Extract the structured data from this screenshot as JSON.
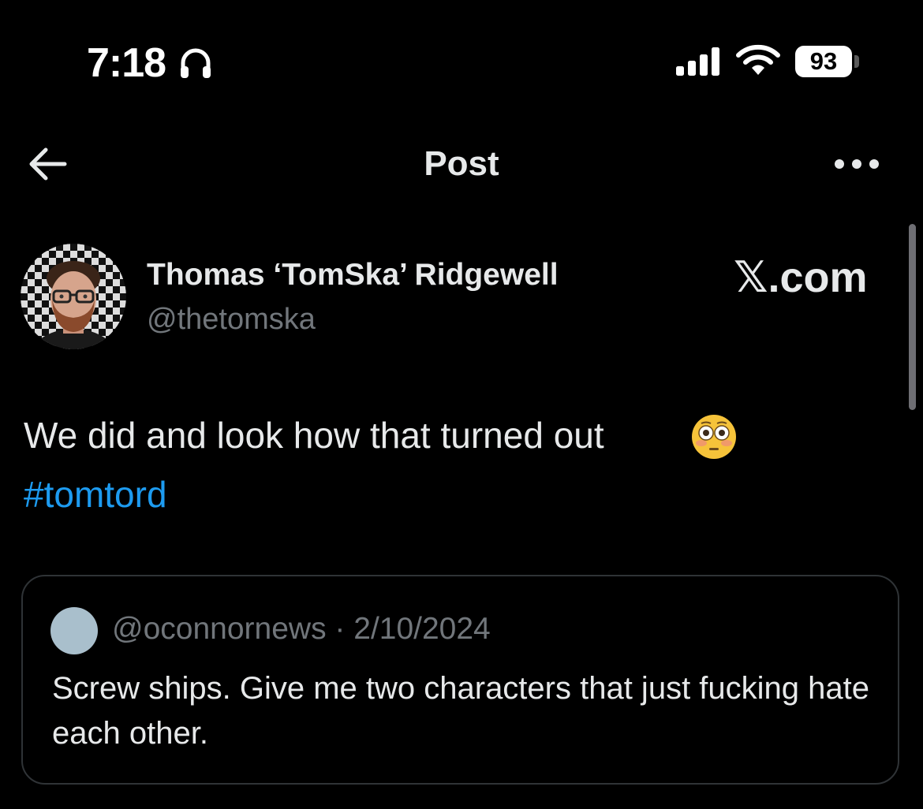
{
  "status_bar": {
    "time": "7:18",
    "battery": "93",
    "icons": [
      "headphones-icon",
      "signal-icon",
      "wifi-icon",
      "battery-icon"
    ]
  },
  "nav": {
    "title": "Post",
    "icons": [
      "back-arrow-icon",
      "more-options-icon"
    ]
  },
  "post": {
    "author_name": "Thomas ‘TomSka’ Ridgewell",
    "author_handle": "@thetomska",
    "watermark": "𝕏.com",
    "text": "We did and look how that turned out",
    "emoji": "flushed-face-emoji",
    "hashtag": "#tomtord"
  },
  "quote": {
    "handle": "@oconnornews",
    "separator": " · ",
    "date": "2/10/2024",
    "text": "Screw ships. Give me two characters that just fucking hate each other."
  },
  "colors": {
    "background": "#000000",
    "primary_text": "#e7e9ea",
    "secondary_text": "#71767b",
    "link": "#1d9bf0",
    "border": "#2f3336"
  }
}
